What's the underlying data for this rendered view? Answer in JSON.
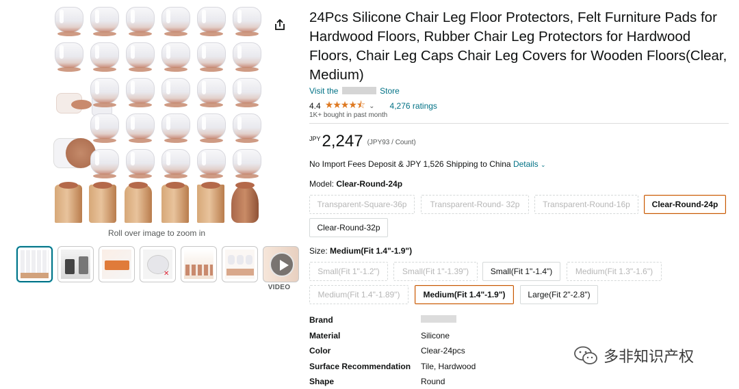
{
  "product": {
    "title": "24Pcs Silicone Chair Leg Floor Protectors, Felt Furniture Pads for Hardwood Floors, Rubber Chair Leg Protectors for Hardwood Floors, Chair Leg Caps Chair Leg Covers for Wooden Floors(Clear, Medium)",
    "store_prefix": "Visit the",
    "store_suffix": "Store",
    "rating": "4.4",
    "stars": "★★★★⯪",
    "ratings_count": "4,276 ratings",
    "bought": "1K+ bought in past month",
    "price_currency": "JPY",
    "price_amount": "2,247",
    "price_unit": "(JPY93 / Count)",
    "shipping_text": "No Import Fees Deposit & JPY 1,526 Shipping to China",
    "shipping_details": "Details"
  },
  "gallery": {
    "zoom_hint": "Roll over image to zoom in",
    "video_label": "VIDEO"
  },
  "model": {
    "label": "Model:",
    "selected": "Clear-Round-24p",
    "options": [
      "Transparent-Square-36p",
      "Transparent-Round- 32p",
      "Transparent-Round-16p",
      "Clear-Round-24p",
      "Clear-Round-32p"
    ]
  },
  "size": {
    "label": "Size:",
    "selected": "Medium(Fit 1.4\"-1.9\")",
    "options": [
      "Small(Fit 1\"-1.2\")",
      "Small(Fit 1\"-1.39\")",
      "Small(Fit 1\"-1.4\")",
      "Medium(Fit 1.3\"-1.6\")",
      "Medium(Fit 1.4\"-1.89\")",
      "Medium(Fit 1.4\"-1.9\")",
      "Large(Fit 2\"-2.8\")"
    ]
  },
  "specs": [
    {
      "key": "Brand",
      "value": ""
    },
    {
      "key": "Material",
      "value": "Silicone"
    },
    {
      "key": "Color",
      "value": "Clear-24pcs"
    },
    {
      "key": "Surface Recommendation",
      "value": "Tile, Hardwood"
    },
    {
      "key": "Shape",
      "value": "Round"
    }
  ],
  "watermark": "多非知识产权",
  "colors": {
    "link": "#007185",
    "selected_border": "#c45500",
    "star": "#de7921"
  }
}
